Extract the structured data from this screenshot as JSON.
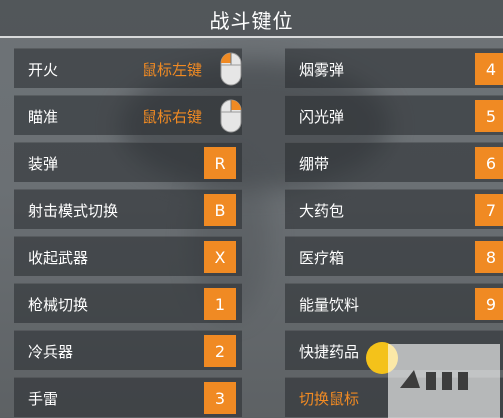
{
  "header": {
    "title": "战斗键位"
  },
  "left_column": [
    {
      "label": "开火",
      "hint": "鼠标左键",
      "icon": "mouse-left-icon"
    },
    {
      "label": "瞄准",
      "hint": "鼠标右键",
      "icon": "mouse-right-icon"
    },
    {
      "label": "装弹",
      "key": "R"
    },
    {
      "label": "射击模式切换",
      "key": "B"
    },
    {
      "label": "收起武器",
      "key": "X"
    },
    {
      "label": "枪械切换",
      "key": "1"
    },
    {
      "label": "冷兵器",
      "key": "2"
    },
    {
      "label": "手雷",
      "key": "3"
    }
  ],
  "right_column": [
    {
      "label": "烟雾弹",
      "key": "4"
    },
    {
      "label": "闪光弹",
      "key": "5"
    },
    {
      "label": "绷带",
      "key": "6"
    },
    {
      "label": "大药包",
      "key": "7"
    },
    {
      "label": "医疗箱",
      "key": "8"
    },
    {
      "label": "能量饮料",
      "key": "9"
    },
    {
      "label": "快捷药品",
      "key": ""
    },
    {
      "label": "切换鼠标",
      "key": ""
    }
  ],
  "colors": {
    "accent": "#f08a23"
  }
}
